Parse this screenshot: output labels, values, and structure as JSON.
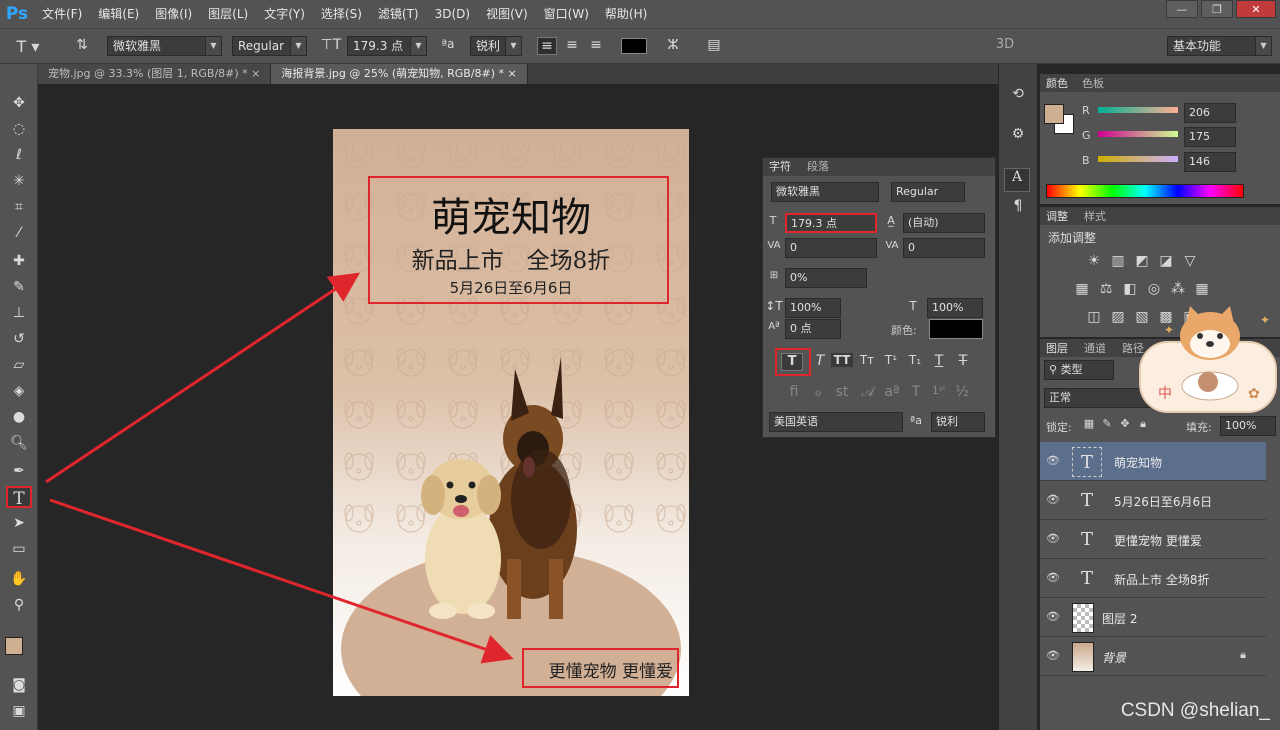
{
  "app": {
    "logo": "Ps"
  },
  "menu": [
    "文件(F)",
    "编辑(E)",
    "图像(I)",
    "图层(L)",
    "文字(Y)",
    "选择(S)",
    "滤镜(T)",
    "3D(D)",
    "视图(V)",
    "窗口(W)",
    "帮助(H)"
  ],
  "window_buttons": {
    "min": "—",
    "restore": "❐",
    "close": "✕"
  },
  "options": {
    "font_family": "微软雅黑",
    "font_style": "Regular",
    "font_size": "179.3 点",
    "aa_label": "ªa",
    "antialias": "锐利",
    "color": "#000000",
    "three_d": "3D",
    "workspace": "基本功能"
  },
  "tabs": [
    {
      "label": "宠物.jpg @ 33.3% (图层 1, RGB/8#) *",
      "close": "×"
    },
    {
      "label": "海报背景.jpg @ 25% (萌宠知物, RGB/8#) *",
      "close": "×"
    }
  ],
  "canvas": {
    "title": "萌宠知物",
    "subtitle": "新品上市　全场8折",
    "date": "5月26日至6月6日",
    "slogan": "更懂宠物  更懂爱"
  },
  "character_panel": {
    "tabs": [
      "字符",
      "段落"
    ],
    "font_family": "微软雅黑",
    "font_style": "Regular",
    "size": "179.3 点",
    "leading": "(自动)",
    "kerning": "0",
    "tracking": "0",
    "tsume": "0%",
    "vscale": "100%",
    "hscale": "100%",
    "baseline": "0 点",
    "color_label": "颜色:",
    "color": "#000000",
    "language": "美国英语",
    "aa_label": "ªa",
    "antialias": "锐利"
  },
  "color_panel": {
    "tabs": [
      "颜色",
      "色板"
    ],
    "r_label": "R",
    "g_label": "G",
    "b_label": "B",
    "r": "206",
    "g": "175",
    "b": "146",
    "fg_color": "#ceaf92"
  },
  "adjust_panel": {
    "tabs": [
      "调整",
      "样式"
    ],
    "title": "添加调整"
  },
  "layers_panel": {
    "tabs": [
      "图层",
      "通道",
      "路径"
    ],
    "filter": "类型",
    "blend": "正常",
    "lock_label": "锁定:",
    "fill_label": "填充:",
    "fill": "100%",
    "layers": [
      {
        "name": "萌宠知物",
        "type": "text",
        "selected": true
      },
      {
        "name": "5月26日至6月6日",
        "type": "text"
      },
      {
        "name": "更懂宠物 更懂爱",
        "type": "text"
      },
      {
        "name": "新品上市  全场8折",
        "type": "text"
      },
      {
        "name": "图层 2",
        "type": "image"
      },
      {
        "name": "背景",
        "type": "background"
      }
    ]
  },
  "watermark": "CSDN @shelian_"
}
